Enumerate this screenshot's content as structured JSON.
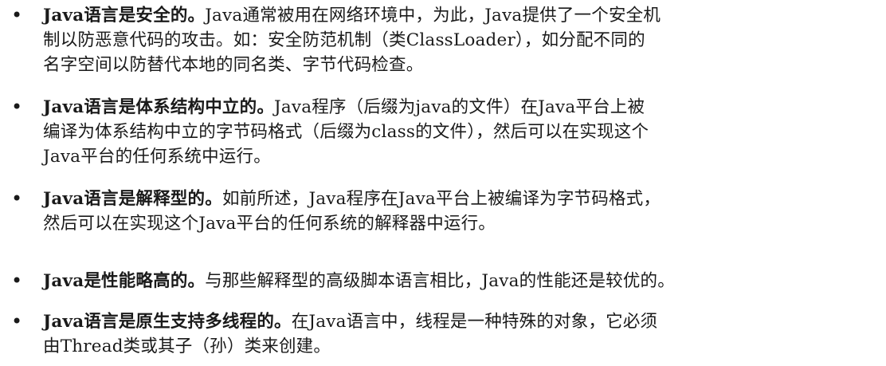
{
  "bullets": [
    {
      "lead": "Java语言是安全的。",
      "lines": [
        "Java通常被用在网络环境中，为此，Java提供了一个安全机",
        "制以防恶意代码的攻击。如：安全防范机制（类ClassLoader），如分配不同的",
        "名字空间以防替代本地的同名类、字节代码检查。"
      ]
    },
    {
      "lead": "Java语言是体系结构中立的。",
      "lines": [
        "Java程序（后缀为java的文件）在Java平台上被",
        "编译为体系结构中立的字节码格式（后缀为class的文件），然后可以在实现这个",
        "Java平台的任何系统中运行。"
      ]
    },
    {
      "lead": "Java语言是解释型的。",
      "lines": [
        "如前所述，Java程序在Java平台上被编译为字节码格式，",
        "然后可以在实现这个Java平台的任何系统的解释器中运行。"
      ]
    },
    {
      "lead": "Java是性能略高的。",
      "lines": [
        "与那些解释型的高级脚本语言相比，Java的性能还是较优的。"
      ]
    },
    {
      "lead": "Java语言是原生支持多线程的。",
      "lines": [
        "在Java语言中，线程是一种特殊的对象，它必须",
        "由Thread类或其子（孙）类来创建。"
      ]
    }
  ],
  "bullet_symbol": "•"
}
